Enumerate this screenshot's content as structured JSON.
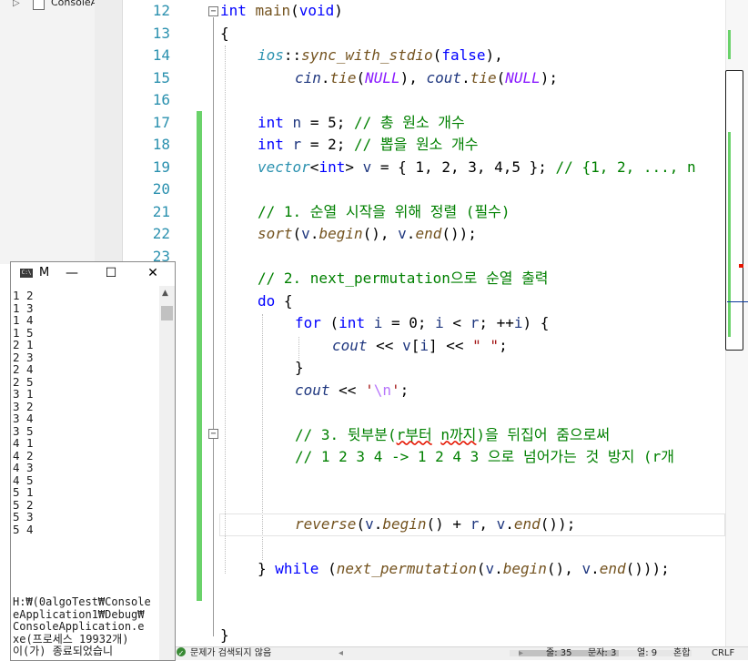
{
  "solution_explorer": {
    "project_label": "ConsoleA"
  },
  "editor": {
    "line_numbers": [
      "12",
      "13",
      "14",
      "15",
      "16",
      "17",
      "18",
      "19",
      "20",
      "21",
      "22",
      "23"
    ],
    "code": {
      "l12": [
        "int",
        " ",
        "main",
        "(",
        "void",
        ")"
      ],
      "l13": "{",
      "l14": [
        "ios",
        "::",
        "sync_with_stdio",
        "(",
        "false",
        "),"
      ],
      "l15": [
        "cin",
        ".",
        "tie",
        "(",
        "NULL",
        "), ",
        "cout",
        ".",
        "tie",
        "(",
        "NULL",
        ");"
      ],
      "l17": [
        "int",
        " ",
        "n",
        " = 5; ",
        "// 총 원소 개수"
      ],
      "l18": [
        "int",
        " ",
        "r",
        " = 2; ",
        "// 뽑을 원소 개수"
      ],
      "l19": [
        "vector",
        "<",
        "int",
        "> ",
        "v",
        " = { 1, 2, 3, 4,5 }; ",
        "// {1, 2, ..., n"
      ],
      "l21": "// 1. 순열 시작을 위해 정렬 (필수)",
      "l22": [
        "sort",
        "(",
        "v",
        ".",
        "begin",
        "(), ",
        "v",
        ".",
        "end",
        "());"
      ],
      "l24": "// 2. next_permutation으로 순열 출력",
      "l25": [
        "do",
        " {"
      ],
      "l26": [
        "for",
        " (",
        "int",
        " ",
        "i",
        " = 0; ",
        "i",
        " < ",
        "r",
        "; ++",
        "i",
        ") {"
      ],
      "l27": [
        "cout",
        " << ",
        "v",
        "[",
        "i",
        "] << ",
        "\" \"",
        ";"
      ],
      "l28": "}",
      "l29": [
        "cout",
        " << ",
        "'",
        "\\n",
        "'",
        ";"
      ],
      "l31a": "// 3. 뒷부분(",
      "l31b": "r부터",
      "l31c": " ",
      "l31d": "n까지",
      "l31e": ")을 뒤집어 줌으로써",
      "l32": "// 1 2 3 4 -> 1 2 4 3 으로 넘어가는 것 방지 (r개",
      "l35": [
        "reverse",
        "(",
        "v",
        ".",
        "begin",
        "() + ",
        "r",
        ", ",
        "v",
        ".",
        "end",
        "());"
      ],
      "l37": [
        "} ",
        "while",
        " (",
        "next_permutation",
        "(",
        "v",
        ".",
        "begin",
        "(), ",
        "v",
        ".",
        "end",
        "()));"
      ],
      "l39": "}"
    }
  },
  "status_bar": {
    "issues": "문제가 검색되지 않음",
    "line": "줄: 35",
    "char": "문자: 3",
    "col": "열: 9",
    "mixed": "혼합",
    "eol": "CRLF"
  },
  "console": {
    "title": "M",
    "icon_text": "C:\\",
    "minimize": "—",
    "maximize": "☐",
    "close": "✕",
    "output": [
      "1 2",
      "1 3",
      "1 4",
      "1 5",
      "2 1",
      "2 3",
      "2 4",
      "2 5",
      "3 1",
      "3 2",
      "3 4",
      "3 5",
      "4 1",
      "4 2",
      "4 3",
      "4 5",
      "5 1",
      "5 2",
      "5 3",
      "5 4"
    ],
    "footer": [
      "H:₩(0algoTest₩Console",
      "eApplication1₩Debug₩",
      "ConsoleApplication.e",
      "xe(프로세스 19932개)",
      "이(가) 종료되었습니"
    ]
  },
  "colors": {
    "change_bar": "#6ad26a",
    "keyword": "#0000ff",
    "comment": "#008000",
    "line_number": "#2b91af"
  }
}
